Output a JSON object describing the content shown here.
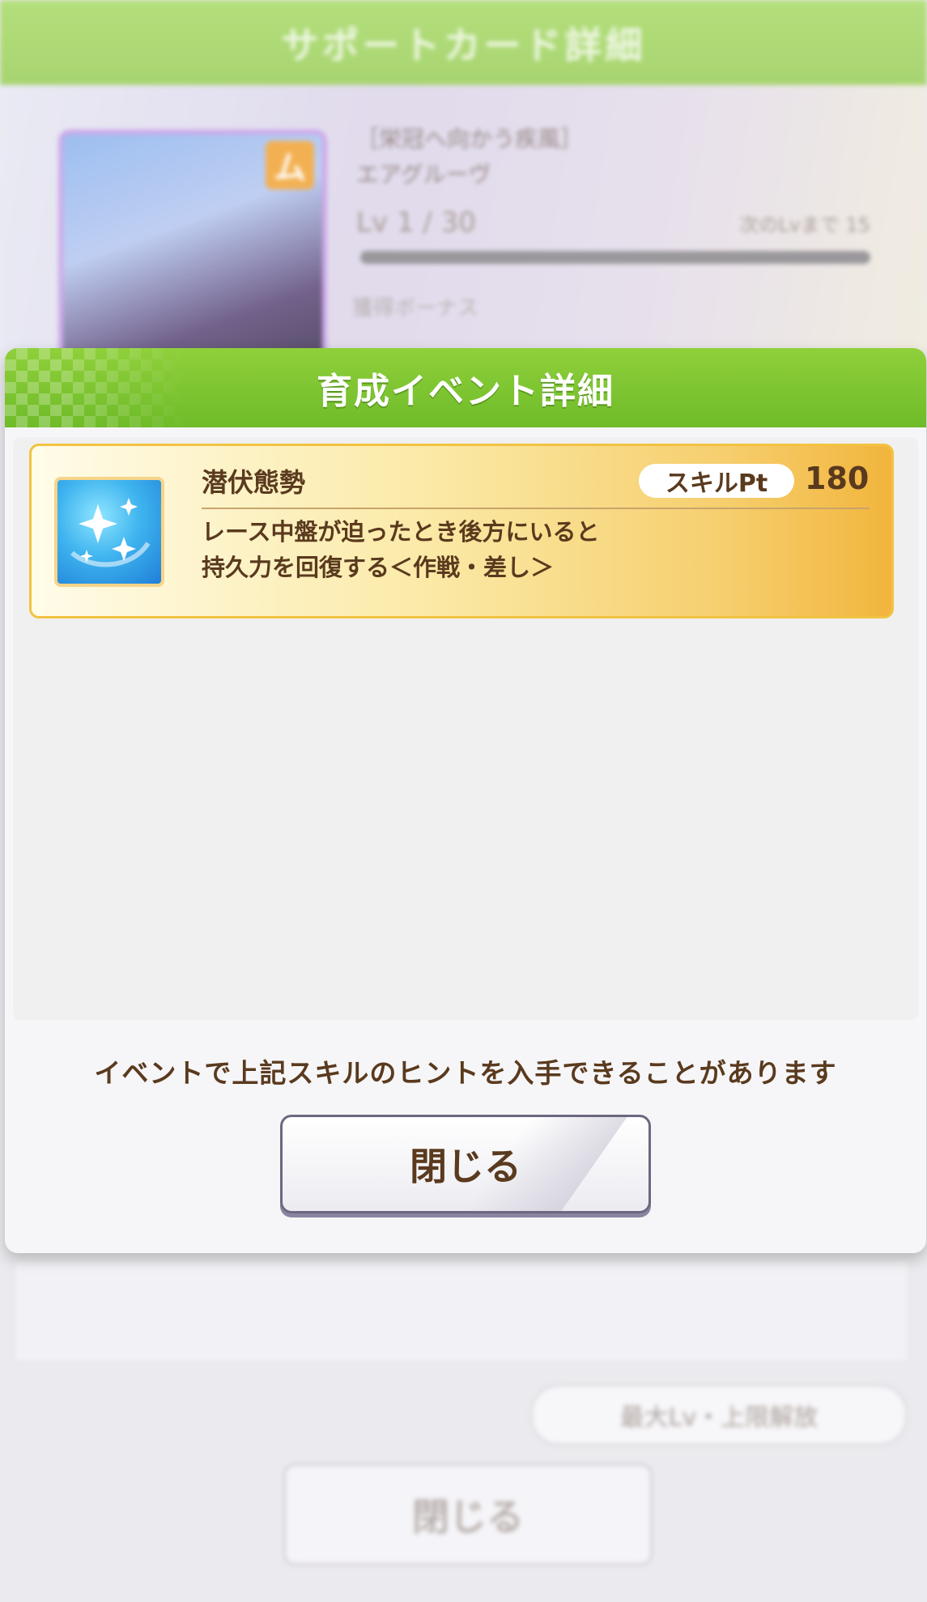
{
  "background": {
    "header_title": "サポートカード詳細",
    "card": {
      "badge": "ム",
      "name_lines": [
        "［栄冠へ向かう疾風］",
        "エアグルーヴ"
      ],
      "level": "Lv 1 / 30",
      "level_note": "次のLvまで 15",
      "sub_label": "獲得ボーナス"
    },
    "limit_button": "最大Lv・上限解放",
    "close_button": "閉じる"
  },
  "modal": {
    "title": "育成イベント詳細",
    "skill": {
      "name": "潜伏態勢",
      "pt_label": "スキルPt",
      "pt_value": "180",
      "description_lines": [
        "レース中盤が迫ったとき後方にいると",
        "持久力を回復する＜作戦・差し＞"
      ],
      "icon": "sparkle-recovery-icon"
    },
    "note": "イベントで上記スキルのヒントを入手できることがあります",
    "close_button": "閉じる"
  },
  "colors": {
    "header_green": "#7cc532",
    "text_brown": "#5a3a1e",
    "skill_gold": "#f2b53d"
  }
}
